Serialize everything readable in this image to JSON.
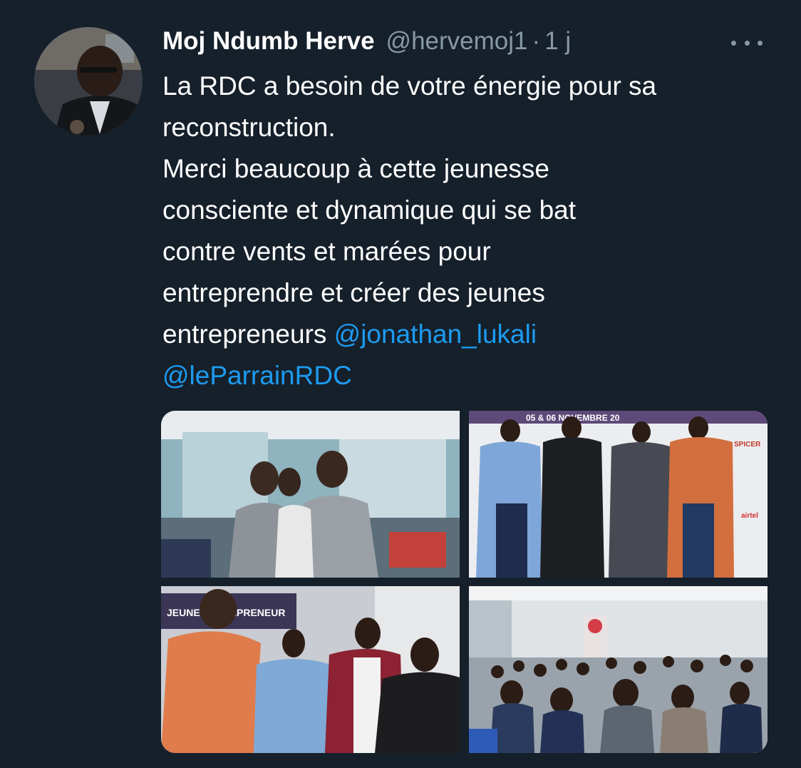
{
  "tweet": {
    "author": {
      "display_name": "Moj Ndumb Herve",
      "handle": "@hervemoj1",
      "separator": "·",
      "time": "1 j",
      "avatar_icon": "profile-photo"
    },
    "more_icon": "more-horizontal-icon",
    "text_lines": [
      "La RDC a besoin de votre énergie pour sa",
      "reconstruction.",
      "Merci beaucoup à cette jeunesse",
      "consciente et dynamique qui se bat",
      "contre vents et marées pour",
      "entreprendre et créer des jeunes",
      "entrepreneurs "
    ],
    "mentions": [
      "@jonathan_lukali",
      "@leParrainRDC"
    ],
    "photos": [
      {
        "name": "photo-networking",
        "banner": ""
      },
      {
        "name": "photo-group-banner",
        "banner": "05 & 06 NOVEMBRE 20",
        "sponsor_1": "SPICER",
        "sponsor_2": "airtel"
      },
      {
        "name": "photo-jeune-entrepreneur",
        "banner": "JEUNE ENTREPRENEUR"
      },
      {
        "name": "photo-audience",
        "banner": ""
      }
    ],
    "colors": {
      "background": "#15202b",
      "text": "#ffffff",
      "muted": "#8899a6",
      "link": "#1d9bf0"
    }
  }
}
